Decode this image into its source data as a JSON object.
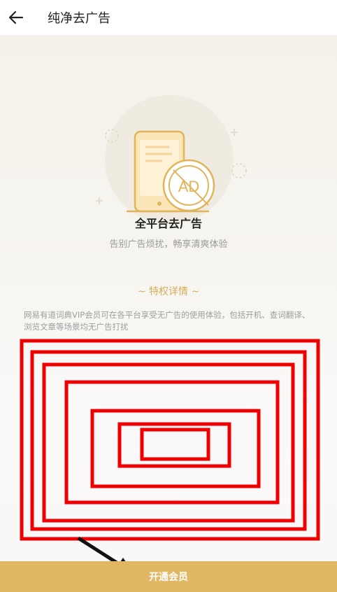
{
  "header": {
    "title": "纯净去广告"
  },
  "hero": {
    "badge_text": "AD",
    "heading": "全平台去广告",
    "subheading": "告别广告烦扰，畅享清爽体验"
  },
  "privileges": {
    "title": "~ 特权详情 ~",
    "description": "网易有道词典VIP会员可在各平台享受无广告的使用体验，包括开机、查词翻译、浏览文章等场景均无广告打扰"
  },
  "cta": {
    "label": "开通会员"
  },
  "colors": {
    "accent": "#e2b763",
    "gold_text": "#d6ad58",
    "annotation_red": "#ee0000"
  }
}
